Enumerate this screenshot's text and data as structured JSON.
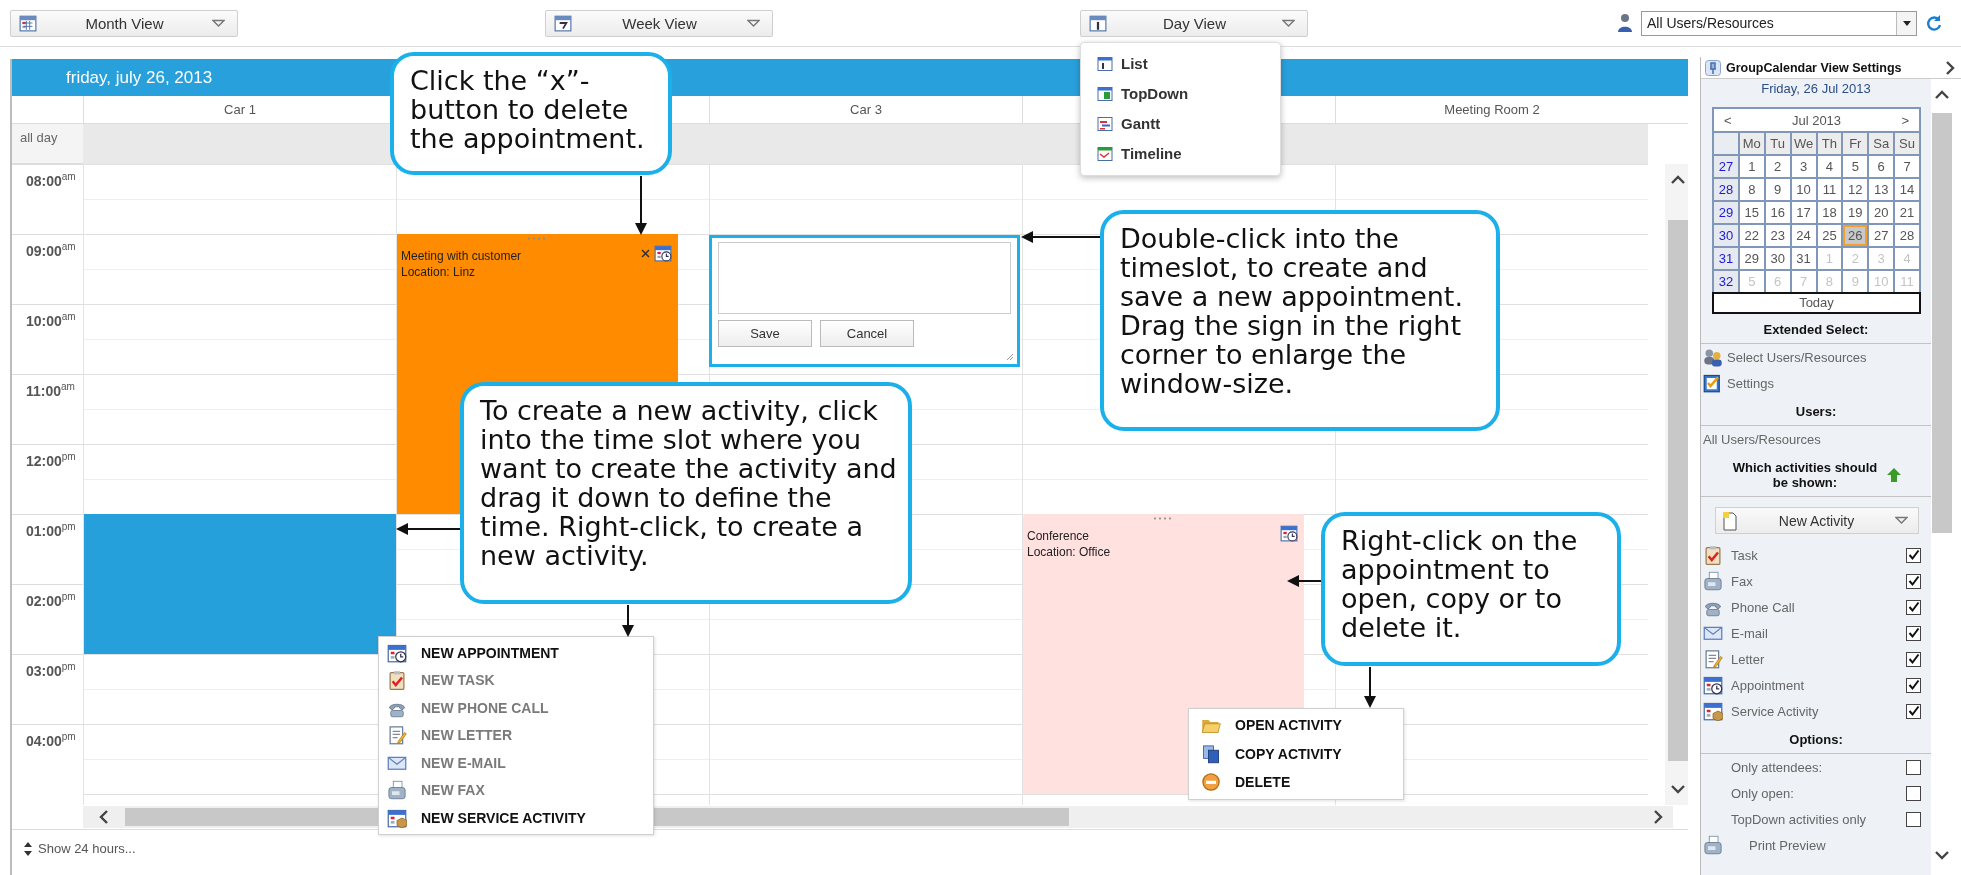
{
  "toolbar": {
    "views": [
      {
        "label": "Month View",
        "kind": "month"
      },
      {
        "label": "Week View",
        "kind": "week"
      },
      {
        "label": "Day View",
        "kind": "day",
        "menu": [
          {
            "label": "List",
            "kind": "list"
          },
          {
            "label": "TopDown",
            "kind": "topdown"
          },
          {
            "label": "Gantt",
            "kind": "gantt"
          },
          {
            "label": "Timeline",
            "kind": "timeline"
          }
        ]
      }
    ],
    "user_filter": {
      "value": "All Users/Resources"
    }
  },
  "calendar": {
    "date_title": "friday, july 26, 2013",
    "all_day_label": "all day",
    "hours": [
      "08:00$^{am}$",
      "09:00$^{am}$",
      "10:00$^{am}$",
      "11:00$^{am}$",
      "12:00$^{pm}$",
      "01:00$^{pm}$",
      "02:00$^{pm}$",
      "03:00$^{pm}$",
      "04:00$^{pm}$"
    ],
    "columns": [
      {
        "name": "Car 1",
        "events": [
          {
            "kind": "selection",
            "color": "#26a0da"
          }
        ]
      },
      {
        "events": [
          {
            "kind": "appointment",
            "color": "#ff8c00",
            "title": "Meeting with customer",
            "location": "Location: Linz",
            "closable": true
          }
        ]
      },
      {
        "name": "Car 3"
      },
      {
        "events": [
          {
            "kind": "appointment",
            "color": "#ffe1df",
            "title": "Conference",
            "location": "Location: Office",
            "closable": false
          }
        ]
      },
      {
        "name": "Meeting Room 2"
      }
    ],
    "quick_create": {
      "buttons": [
        "Save",
        "Cancel"
      ]
    },
    "footer_link": "Show 24 hours..."
  },
  "new_menu": [
    {
      "label": "NEW APPOINTMENT",
      "kind": "appointment",
      "disabled": false
    },
    {
      "label": "NEW TASK",
      "kind": "task",
      "disabled": true
    },
    {
      "label": "NEW PHONE CALL",
      "kind": "phone",
      "disabled": true
    },
    {
      "label": "NEW LETTER",
      "kind": "letter",
      "disabled": true
    },
    {
      "label": "NEW E-MAIL",
      "kind": "email",
      "disabled": true
    },
    {
      "label": "NEW FAX",
      "kind": "fax",
      "disabled": true
    },
    {
      "label": "NEW SERVICE ACTIVITY",
      "kind": "service",
      "disabled": false
    }
  ],
  "activity_menu": [
    {
      "label": "OPEN ACTIVITY",
      "kind": "open"
    },
    {
      "label": "COPY ACTIVITY",
      "kind": "copy"
    },
    {
      "label": "DELETE",
      "kind": "delete"
    }
  ],
  "callouts": [
    {
      "text": "Click the “x”-button to delete the appointment."
    },
    {
      "text": "Double-click into the timeslot, to create and save a new appointment. Drag the sign in the right corner to enlarge the window-size."
    },
    {
      "text": "To create a new activity, click into the time slot where you want to create the activity and drag it down to define the time. Right-click, to create a new activity."
    },
    {
      "text": "Right-click on the appointment to open, copy or to delete it."
    }
  ],
  "sidebar": {
    "title": "GroupCalendar View Settings",
    "date": "Friday, 26 Jul 2013",
    "mini_calendar": {
      "prev": "<",
      "month": "Jul 2013",
      "next": ">",
      "weekdays": [
        "Mo",
        "Tu",
        "We",
        "Th",
        "Fr",
        "Sa",
        "Su"
      ],
      "weeks": [
        {
          "week": "27",
          "days": [
            {
              "day": "1",
              "outside_month": false,
              "selected": false
            },
            {
              "day": "2",
              "outside_month": false,
              "selected": false
            },
            {
              "day": "3",
              "outside_month": false,
              "selected": false
            },
            {
              "day": "4",
              "outside_month": false,
              "selected": false
            },
            {
              "day": "5",
              "outside_month": false,
              "selected": false
            },
            {
              "day": "6",
              "outside_month": false,
              "selected": false
            },
            {
              "day": "7",
              "outside_month": false,
              "selected": false
            }
          ]
        },
        {
          "week": "28",
          "days": [
            {
              "day": "8",
              "outside_month": false,
              "selected": false
            },
            {
              "day": "9",
              "outside_month": false,
              "selected": false
            },
            {
              "day": "10",
              "outside_month": false,
              "selected": false
            },
            {
              "day": "11",
              "outside_month": false,
              "selected": false
            },
            {
              "day": "12",
              "outside_month": false,
              "selected": false
            },
            {
              "day": "13",
              "outside_month": false,
              "selected": false
            },
            {
              "day": "14",
              "outside_month": false,
              "selected": false
            }
          ]
        },
        {
          "week": "29",
          "days": [
            {
              "day": "15",
              "outside_month": false,
              "selected": false
            },
            {
              "day": "16",
              "outside_month": false,
              "selected": false
            },
            {
              "day": "17",
              "outside_month": false,
              "selected": false
            },
            {
              "day": "18",
              "outside_month": false,
              "selected": false
            },
            {
              "day": "19",
              "outside_month": false,
              "selected": false
            },
            {
              "day": "20",
              "outside_month": false,
              "selected": false
            },
            {
              "day": "21",
              "outside_month": false,
              "selected": false
            }
          ]
        },
        {
          "week": "30",
          "days": [
            {
              "day": "22",
              "outside_month": false,
              "selected": false
            },
            {
              "day": "23",
              "outside_month": false,
              "selected": false
            },
            {
              "day": "24",
              "outside_month": false,
              "selected": false
            },
            {
              "day": "25",
              "outside_month": false,
              "selected": false
            },
            {
              "day": "26",
              "outside_month": false,
              "selected": true
            },
            {
              "day": "27",
              "outside_month": false,
              "selected": false
            },
            {
              "day": "28",
              "outside_month": false,
              "selected": false
            }
          ]
        },
        {
          "week": "31",
          "days": [
            {
              "day": "29",
              "outside_month": false,
              "selected": false
            },
            {
              "day": "30",
              "outside_month": false,
              "selected": false
            },
            {
              "day": "31",
              "outside_month": false,
              "selected": false
            },
            {
              "day": "1",
              "outside_month": true,
              "selected": false
            },
            {
              "day": "2",
              "outside_month": true,
              "selected": false
            },
            {
              "day": "3",
              "outside_month": true,
              "selected": false
            },
            {
              "day": "4",
              "outside_month": true,
              "selected": false
            }
          ]
        },
        {
          "week": "32",
          "days": [
            {
              "day": "5",
              "outside_month": true,
              "selected": false
            },
            {
              "day": "6",
              "outside_month": true,
              "selected": false
            },
            {
              "day": "7",
              "outside_month": true,
              "selected": false
            },
            {
              "day": "8",
              "outside_month": true,
              "selected": false
            },
            {
              "day": "9",
              "outside_month": true,
              "selected": false
            },
            {
              "day": "10",
              "outside_month": true,
              "selected": false
            },
            {
              "day": "11",
              "outside_month": true,
              "selected": false
            }
          ]
        }
      ],
      "today": "Today"
    },
    "extended_select_heading": "Extended Select:",
    "links": [
      {
        "label": "Select Users/Resources",
        "kind": "users"
      },
      {
        "label": "Settings",
        "kind": "settings"
      }
    ],
    "users_heading": "Users:",
    "users_value": "All Users/Resources",
    "activities_heading": "Which activities should be shown:",
    "new_activity_button": "New Activity",
    "activity_types": [
      {
        "label": "Task",
        "kind": "task",
        "checked": true
      },
      {
        "label": "Fax",
        "kind": "fax",
        "checked": true
      },
      {
        "label": "Phone Call",
        "kind": "phone",
        "checked": true
      },
      {
        "label": "E-mail",
        "kind": "email",
        "checked": true
      },
      {
        "label": "Letter",
        "kind": "letter",
        "checked": true
      },
      {
        "label": "Appointment",
        "kind": "appointment",
        "checked": true
      },
      {
        "label": "Service Activity",
        "kind": "service",
        "checked": true
      }
    ],
    "options_heading": "Options:",
    "options": [
      {
        "label": "Only attendees:",
        "checked": false
      },
      {
        "label": "Only open:",
        "checked": false
      },
      {
        "label": "TopDown activities only",
        "checked": false
      }
    ],
    "print_preview": "Print Preview"
  }
}
